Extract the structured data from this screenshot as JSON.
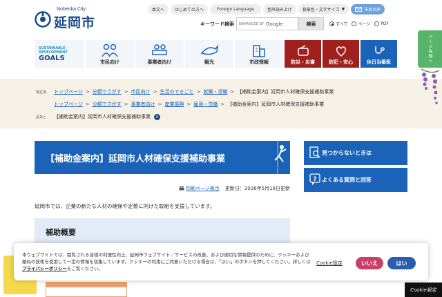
{
  "header": {
    "logo_small": "Nobeoka City",
    "logo_text": "延岡市",
    "topnav": [
      {
        "label": "本文へ"
      },
      {
        "label": "はじめての方へ"
      },
      {
        "label": "Foreign Language"
      },
      {
        "label": "音声読み上げ"
      },
      {
        "label": "背景色・文字サイズ"
      },
      {
        "label": "市民の声"
      }
    ],
    "search": {
      "label": "キーワード検索",
      "enhanced": "ENHANCED BY",
      "google": "Google",
      "button": "検索",
      "options": [
        "すべて",
        "ページ",
        "PDF"
      ],
      "selected": "すべて"
    },
    "side_tab": "ページ先頭へ"
  },
  "mainnav": {
    "sdgs_top": "SUSTAINABLE DEVELOPMENT",
    "sdgs_bottom": "GOALS",
    "items": [
      {
        "label": "市民向け"
      },
      {
        "label": "事業者向け"
      },
      {
        "label": "観光"
      },
      {
        "label": "市政情報"
      },
      {
        "label": "防災・災害"
      },
      {
        "label": "防犯・安心"
      },
      {
        "label": "休日当番医"
      }
    ]
  },
  "breadcrumbs": {
    "current_label": "現在地",
    "row1": [
      "トップページ",
      "分類でさがす",
      "市民向け",
      "生活のできごと",
      "就職・退職"
    ],
    "row2": [
      "トップページ",
      "分類でさがす",
      "事業者向け",
      "産業振興",
      "雇用・労働"
    ],
    "current": "【補助金案内】延岡市人材確保支援補助事業",
    "history_label": "足あと",
    "history_item": "【補助金案内】延岡市人材確保支援補助事業"
  },
  "content": {
    "title": "【補助金案内】延岡市人材確保支援補助事業",
    "print_label": "印刷ページ表示",
    "updated": "更新日：2026年5月19日更新",
    "intro": "延岡市では、企業の新たな人材の確保や定着に向けた取組を支援しています。",
    "section_heading": "補助概要"
  },
  "sidebar": {
    "btn1": "見つからないときは",
    "btn2": "よくある質問と回答"
  },
  "cookie": {
    "text_before": "本ウェブサイトでは、閲覧される皆様の利便性向上、延岡市ウェブサイト／サービスの改善、および適切な情報提供のために、クッキーおよび類似の技術を使用して一定の情報を収集しています。クッキーの利用にご同意いただける場合は、「はい」のボタンを押してください。詳しくは",
    "policy_link": "プライバシーポリシー",
    "text_after": "をご覧ください。",
    "settings": "Cookie設定",
    "no": "いいえ",
    "yes": "はい",
    "corner": "Cookie設定"
  },
  "colors": {
    "primary": "#1a63b8",
    "red": "#a0201e",
    "crumb_bg": "#f6f1e6"
  }
}
